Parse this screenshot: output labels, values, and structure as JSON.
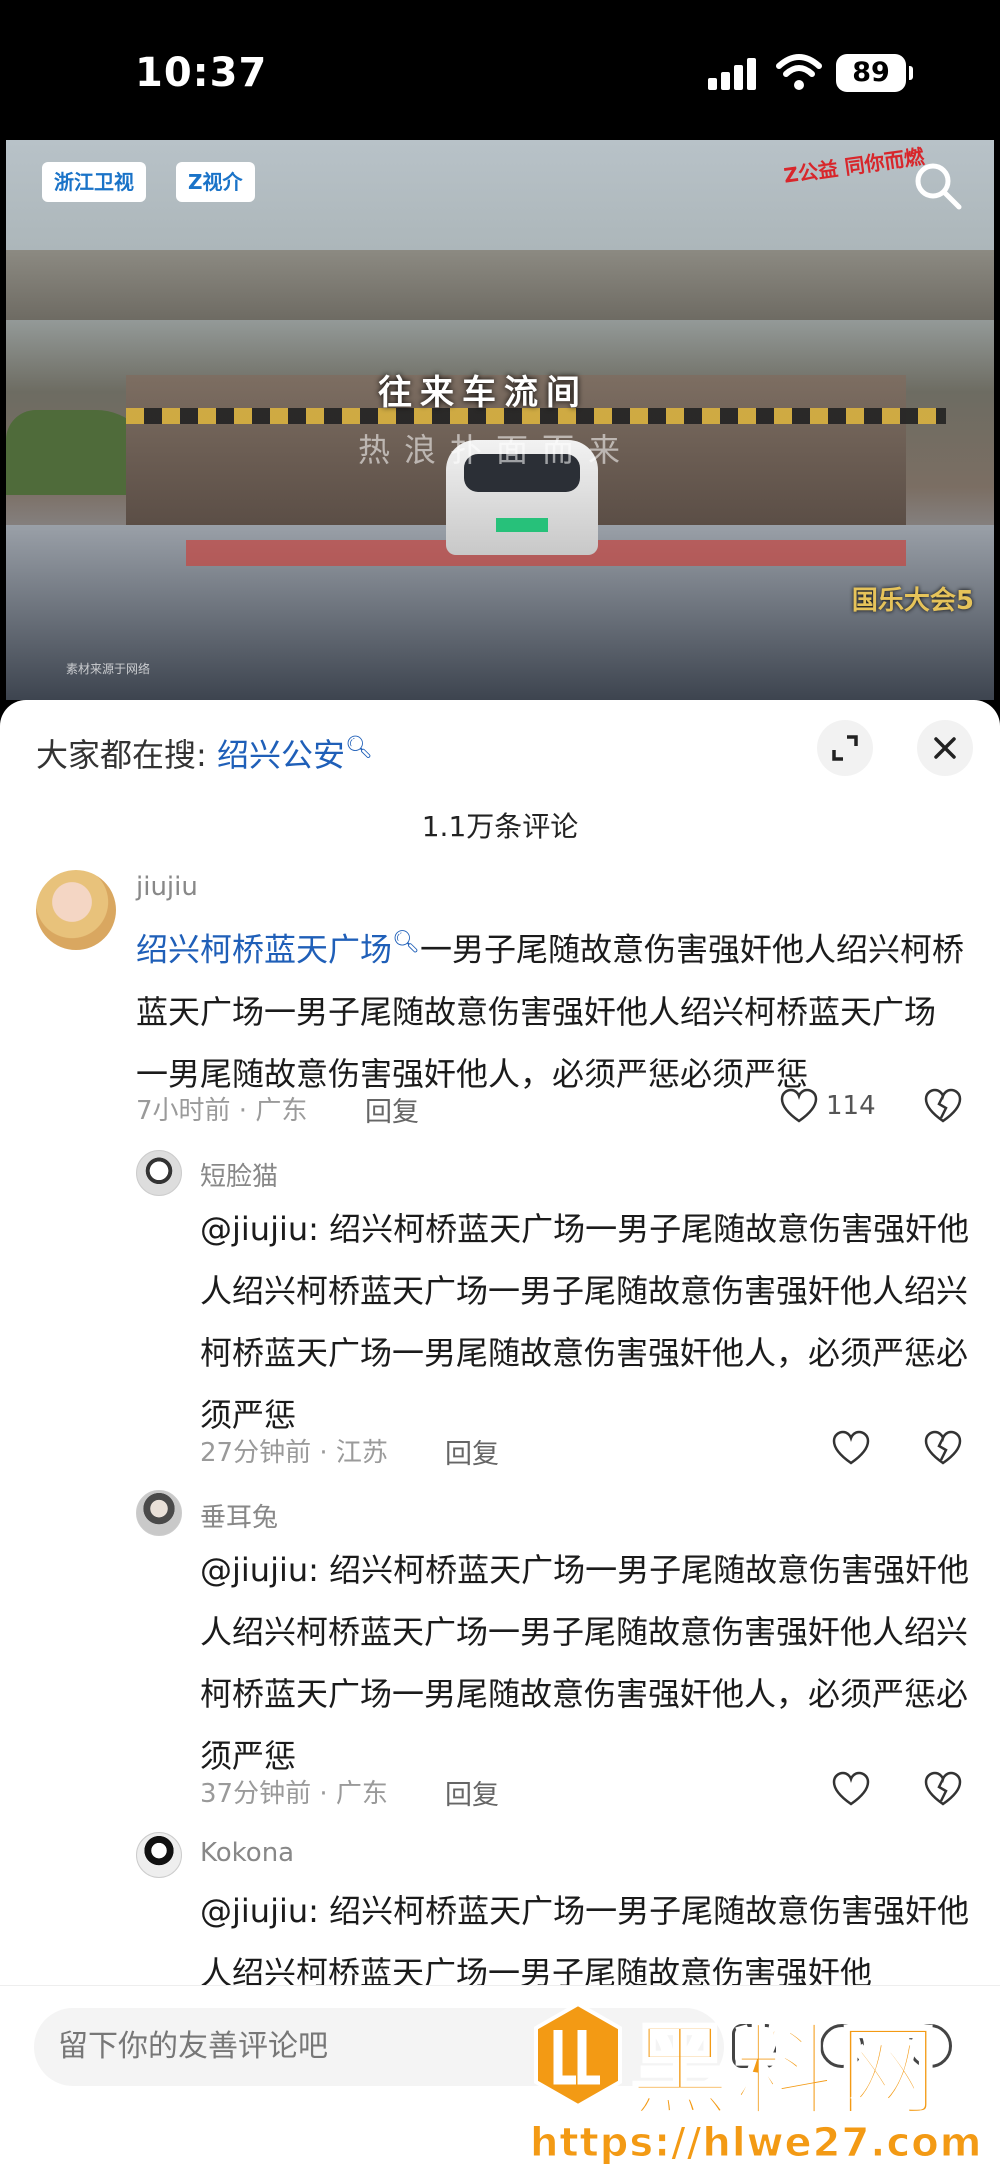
{
  "status_bar": {
    "time": "10:37",
    "battery": "89"
  },
  "video": {
    "chip_1": "浙江卫视",
    "chip_2": "Z视介",
    "overlay_line_1": "往来车流间",
    "overlay_line_2": "热浪扑面而来",
    "brand_top": "Z公益 同你而燃",
    "brand_bottom": "国乐大会5",
    "credit": "素材来源于网络"
  },
  "hot_search": {
    "prefix": "大家都在搜: ",
    "term": "绍兴公安"
  },
  "comment_count": "1.1万条评论",
  "comments": [
    {
      "user": "jiujiu",
      "highlight": "绍兴柯桥蓝天广场",
      "text": "一男子尾随故意伤害强奸他人绍兴柯桥蓝天广场一男子尾随故意伤害强奸他人绍兴柯桥蓝天广场一男尾随故意伤害强奸他人，必须严惩必须严惩",
      "meta": "7小时前 · 广东",
      "reply": "回复",
      "likes": "114"
    },
    {
      "user": "短脸猫",
      "text": "@jiujiu: 绍兴柯桥蓝天广场一男子尾随故意伤害强奸他人绍兴柯桥蓝天广场一男子尾随故意伤害强奸他人绍兴柯桥蓝天广场一男尾随故意伤害强奸他人，必须严惩必须严惩",
      "meta": "27分钟前 · 江苏",
      "reply": "回复"
    },
    {
      "user": "垂耳兔",
      "text": "@jiujiu: 绍兴柯桥蓝天广场一男子尾随故意伤害强奸他人绍兴柯桥蓝天广场一男子尾随故意伤害强奸他人绍兴柯桥蓝天广场一男尾随故意伤害强奸他人，必须严惩必须严惩",
      "meta": "37分钟前 · 广东",
      "reply": "回复"
    },
    {
      "user": "Kokona",
      "text": "@jiujiu: 绍兴柯桥蓝天广场一男子尾随故意伤害强奸他人绍兴柯桥蓝天广场一男子尾随故意伤害强奸他"
    }
  ],
  "input": {
    "placeholder": "留下你的友善评论吧"
  },
  "watermark": {
    "text": "黑料网",
    "url": "https://hlwe27.com"
  },
  "colors": {
    "link": "#1f5fb8",
    "watermark": "#f39a14"
  }
}
